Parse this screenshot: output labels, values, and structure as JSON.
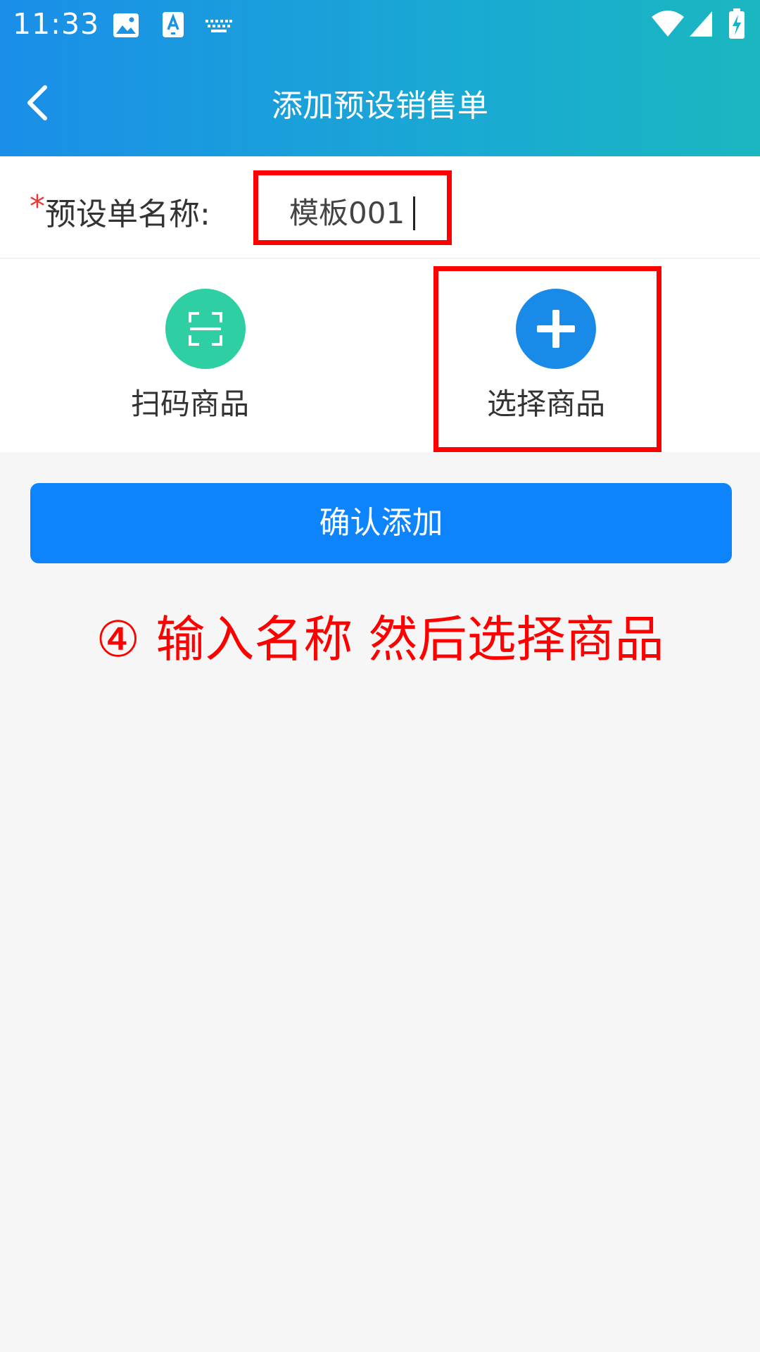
{
  "status_bar": {
    "time": "11:33",
    "icons": [
      "image-icon",
      "text-a-icon",
      "keyboard-icon",
      "wifi-icon",
      "signal-icon",
      "battery-charging-icon"
    ]
  },
  "header": {
    "title": "添加预设销售单",
    "back_icon": "chevron-left-icon",
    "gradient_start": "#1a8ee8",
    "gradient_end": "#1ab7c0"
  },
  "form": {
    "required_marker": "*",
    "name_label": "预设单名称:",
    "name_value": "模板001"
  },
  "actions": {
    "scan_label": "扫码商品",
    "scan_icon": "scan-icon",
    "scan_color": "#2ecfa2",
    "select_label": "选择商品",
    "select_icon": "plus-icon",
    "select_color": "#1a8ae8"
  },
  "confirm_button": {
    "label": "确认添加",
    "color": "#0d84fb"
  },
  "annotation": {
    "text": "④ 输入名称 然后选择商品",
    "color": "#ff0000"
  }
}
